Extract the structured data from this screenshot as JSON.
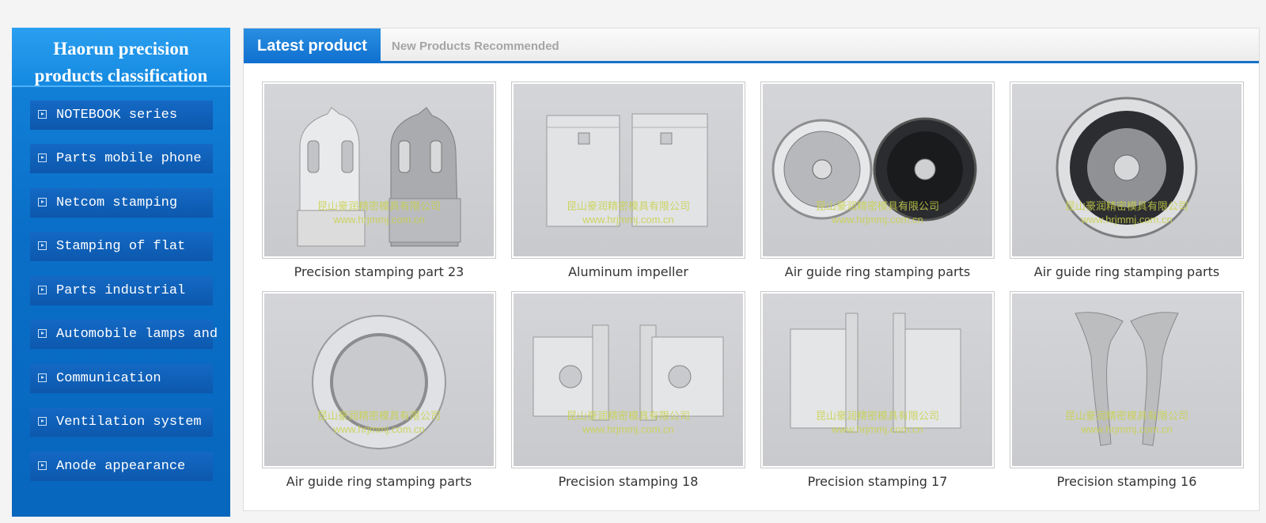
{
  "sidebar": {
    "title_line1": "Haorun precision",
    "title_line2": "products classification",
    "items": [
      {
        "label": "NOTEBOOK series"
      },
      {
        "label": "Parts mobile phone"
      },
      {
        "label": "Netcom stamping"
      },
      {
        "label": "Stamping of flat"
      },
      {
        "label": "Parts industrial"
      },
      {
        "label": "Automobile lamps and"
      },
      {
        "label": "Communication"
      },
      {
        "label": "Ventilation system"
      },
      {
        "label": "Anode appearance"
      }
    ]
  },
  "tabs": {
    "active": "Latest product",
    "inactive": "New Products Recommended"
  },
  "watermark": {
    "cn": "昆山豪润精密模具有限公司",
    "url": "www.hrjmmj.com.cn"
  },
  "products": [
    {
      "caption": "Precision stamping part 23",
      "image": "brackets-pair"
    },
    {
      "caption": "Aluminum impeller",
      "image": "plates-pair"
    },
    {
      "caption": "Air guide ring stamping parts",
      "image": "fan-pair"
    },
    {
      "caption": "Air guide ring stamping parts",
      "image": "fan-single"
    },
    {
      "caption": "Air guide ring stamping parts",
      "image": "ring"
    },
    {
      "caption": "Precision stamping 18",
      "image": "panel-hole-pair"
    },
    {
      "caption": "Precision stamping 17",
      "image": "panel-pair"
    },
    {
      "caption": "Precision stamping 16",
      "image": "blade-pair"
    }
  ],
  "colors": {
    "accent": "#0f6fcf",
    "sidebar": "#0a6fc8",
    "watermark": "#c9d24a"
  }
}
